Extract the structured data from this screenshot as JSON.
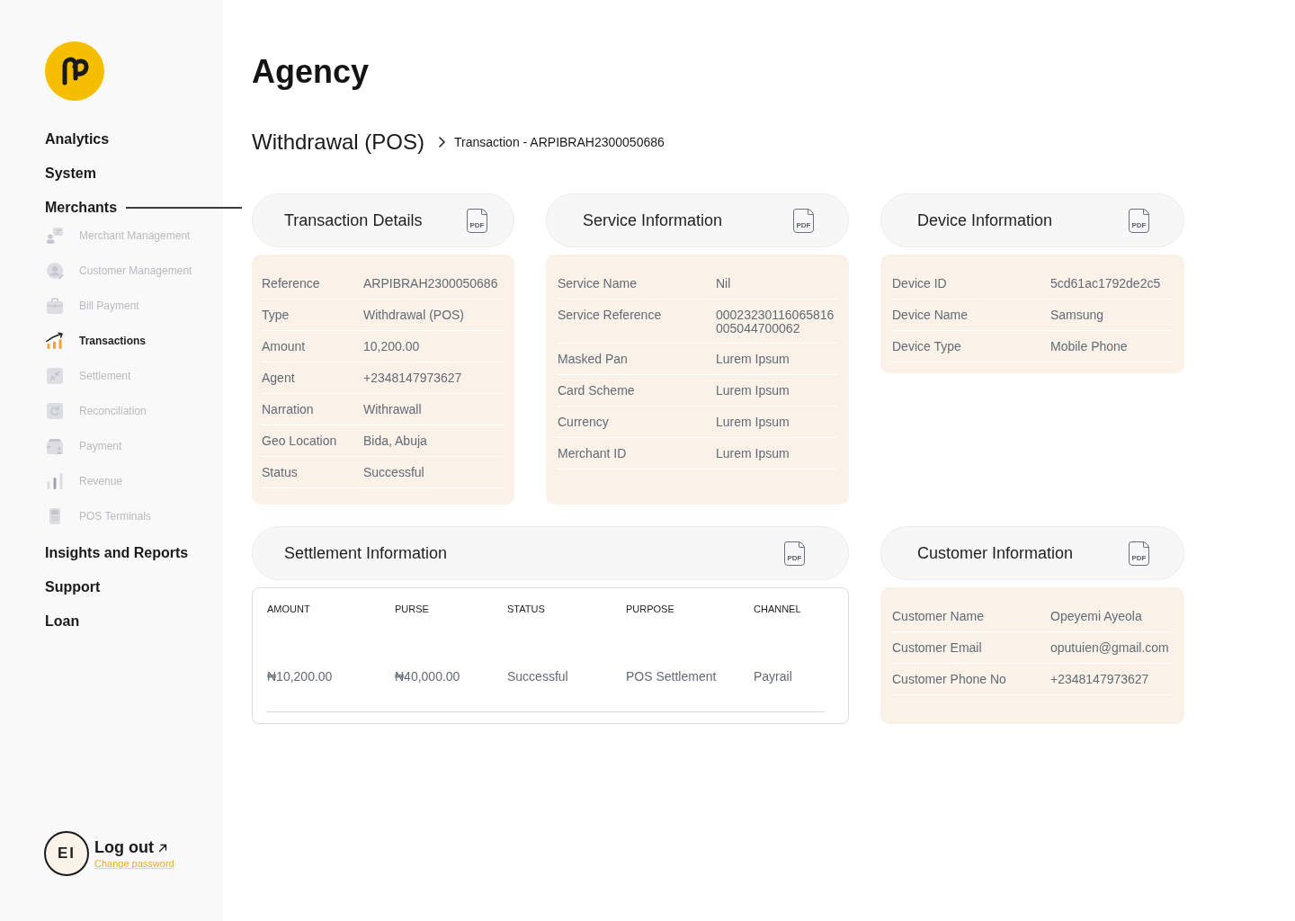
{
  "sidebar": {
    "nav": [
      {
        "label": "Analytics",
        "expanded": false
      },
      {
        "label": "System",
        "expanded": false
      },
      {
        "label": "Merchants",
        "expanded": true,
        "children": [
          {
            "label": "Merchant Management",
            "selected": false
          },
          {
            "label": "Customer Management",
            "selected": false
          },
          {
            "label": "Bill Payment",
            "selected": false
          },
          {
            "label": "Transactions",
            "selected": true
          },
          {
            "label": "Settlement",
            "selected": false
          },
          {
            "label": "Reconciliation",
            "selected": false
          },
          {
            "label": "Payment",
            "selected": false
          },
          {
            "label": "Revenue",
            "selected": false
          },
          {
            "label": "POS Terminals",
            "selected": false
          }
        ]
      },
      {
        "label": "Insights and Reports",
        "expanded": false
      },
      {
        "label": "Support",
        "expanded": false
      },
      {
        "label": "Loan",
        "expanded": false
      }
    ],
    "profile": {
      "initials": "EI",
      "logout": "Log out",
      "change_password": "Change password"
    }
  },
  "page": {
    "title": "Agency",
    "breadcrumb": {
      "parent": "Withdrawal (POS)",
      "current": "Transaction - ARPIBRAH2300050686"
    }
  },
  "transaction_details": {
    "title": "Transaction Details",
    "export_label": "PDF",
    "rows": [
      {
        "label": "Reference",
        "value": "ARPIBRAH2300050686"
      },
      {
        "label": "Type",
        "value": "Withdrawal (POS)"
      },
      {
        "label": "Amount",
        "value": "10,200.00"
      },
      {
        "label": "Agent",
        "value": "+2348147973627"
      },
      {
        "label": "Narration",
        "value": "Withrawall"
      },
      {
        "label": "Geo Location",
        "value": "Bida, Abuja"
      },
      {
        "label": "Status",
        "value": "Successful"
      }
    ]
  },
  "service_information": {
    "title": "Service Information",
    "export_label": "PDF",
    "rows": [
      {
        "label": "Service Name",
        "value": "Nil"
      },
      {
        "label": "Service Reference",
        "value": "00023230116065816 005044700062"
      },
      {
        "label": "Masked Pan",
        "value": "Lurem Ipsum"
      },
      {
        "label": "Card Scheme",
        "value": "Lurem Ipsum"
      },
      {
        "label": "Currency",
        "value": "Lurem Ipsum"
      },
      {
        "label": "Merchant ID",
        "value": "Lurem Ipsum"
      }
    ]
  },
  "device_information": {
    "title": "Device Information",
    "export_label": "PDF",
    "rows": [
      {
        "label": "Device ID",
        "value": "5cd61ac1792de2c5"
      },
      {
        "label": "Device Name",
        "value": "Samsung"
      },
      {
        "label": "Device Type",
        "value": "Mobile Phone"
      }
    ]
  },
  "settlement_information": {
    "title": "Settlement Information",
    "export_label": "PDF",
    "table": {
      "columns": [
        "AMOUNT",
        "PURSE",
        "STATUS",
        "PURPOSE",
        "CHANNEL"
      ],
      "rows": [
        [
          "₦10,200.00",
          "₦40,000.00",
          "Successful",
          "POS Settlement",
          "Payrail"
        ]
      ]
    }
  },
  "customer_information": {
    "title": "Customer Information",
    "export_label": "PDF",
    "rows": [
      {
        "label": "Customer Name",
        "value": "Opeyemi Ayeola"
      },
      {
        "label": "Customer Email",
        "value": "oputuien@gmail.com"
      },
      {
        "label": "Customer Phone No",
        "value": "+2348147973627"
      }
    ]
  }
}
